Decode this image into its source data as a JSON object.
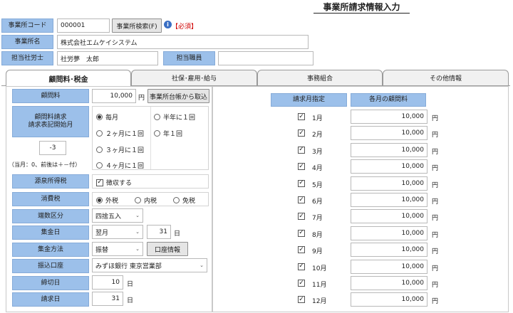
{
  "page": {
    "title": "事業所請求情報入力"
  },
  "header": {
    "office_code_label": "事業所コード",
    "office_code_value": "000001",
    "office_search_button": "事業所検索(F)",
    "required_mark": "【必須】",
    "office_name_label": "事業所名",
    "office_name_value": "株式会社エムケイシステム",
    "labor_consultant_label": "担当社労士",
    "labor_consultant_value": "社労夢　太郎",
    "staff_label": "担当職員",
    "staff_value": ""
  },
  "tabs": [
    {
      "label": "顧問料･税金"
    },
    {
      "label": "社保･雇用･給与"
    },
    {
      "label": "事務組合"
    },
    {
      "label": "その他情報"
    }
  ],
  "left": {
    "fee_label": "顧問料",
    "fee_value": "10,000",
    "fee_unit": "円",
    "fee_button": "事業所台帳から取込",
    "billing_start_label": "顧問料請求\n請求表記開始月",
    "billing_start_value": "-3",
    "billing_start_note": "（当月：0、前後は＋－付）",
    "cycle_options": [
      {
        "label": "毎月",
        "selected": true
      },
      {
        "label": "２ヶ月に１回",
        "selected": false
      },
      {
        "label": "３ヶ月に１回",
        "selected": false
      },
      {
        "label": "４ヶ月に１回",
        "selected": false
      },
      {
        "label": "半年に１回",
        "selected": false
      },
      {
        "label": "年１回",
        "selected": false
      }
    ],
    "withholding_label": "源泉所得税",
    "withholding_check_label": "徴収する",
    "withholding_checked": true,
    "tax_label": "消費税",
    "tax_options": [
      {
        "label": "外税",
        "selected": true
      },
      {
        "label": "内税",
        "selected": false
      },
      {
        "label": "免税",
        "selected": false
      }
    ],
    "rounding_label": "端数区分",
    "rounding_value": "四捨五入",
    "collection_day_label": "集金日",
    "collection_month_value": "翌月",
    "collection_day_value": "31",
    "collection_day_unit": "日",
    "collection_method_label": "集金方法",
    "collection_method_value": "振替",
    "account_info_button": "口座情報",
    "transfer_account_label": "振込口座",
    "transfer_account_value": "みずほ銀行 東京営業部",
    "closing_day_label": "締切日",
    "closing_day_value": "10",
    "closing_day_unit": "日",
    "invoice_day_label": "請求日",
    "invoice_day_value": "31",
    "invoice_day_unit": "日"
  },
  "right": {
    "month_header": "請求月指定",
    "fee_header": "各月の顧問料",
    "currency": "円",
    "months": [
      {
        "label": "1月",
        "checked": true,
        "amount": "10,000"
      },
      {
        "label": "2月",
        "checked": true,
        "amount": "10,000"
      },
      {
        "label": "3月",
        "checked": true,
        "amount": "10,000"
      },
      {
        "label": "4月",
        "checked": true,
        "amount": "10,000"
      },
      {
        "label": "5月",
        "checked": true,
        "amount": "10,000"
      },
      {
        "label": "6月",
        "checked": true,
        "amount": "10,000"
      },
      {
        "label": "7月",
        "checked": true,
        "amount": "10,000"
      },
      {
        "label": "8月",
        "checked": true,
        "amount": "10,000"
      },
      {
        "label": "9月",
        "checked": true,
        "amount": "10,000"
      },
      {
        "label": "10月",
        "checked": true,
        "amount": "10,000"
      },
      {
        "label": "11月",
        "checked": true,
        "amount": "10,000"
      },
      {
        "label": "12月",
        "checked": true,
        "amount": "10,000"
      }
    ]
  },
  "colors": {
    "label_bg": "#9cc0ea",
    "required": "#d00000",
    "info_icon": "#3a6fc4"
  }
}
